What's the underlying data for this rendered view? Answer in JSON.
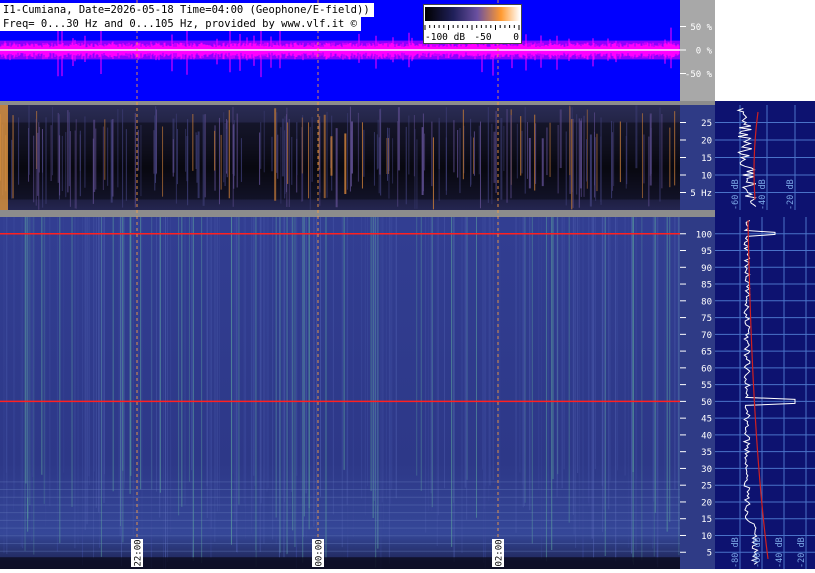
{
  "header": {
    "line1": "I1-Cumiana, Date=2026-05-18 Time=04:00 (Geophone/E-field))",
    "line2": "Freq= 0...30 Hz and 0...105 Hz, provided by www.vlf.it ©"
  },
  "colorbar": {
    "ticks": [
      "-100 dB",
      "-50",
      "0"
    ],
    "colors": [
      "#000000",
      "#20205a",
      "#6a50a0",
      "#ff9a30",
      "#ffffff"
    ]
  },
  "chart_data": [
    {
      "type": "line",
      "name": "waveform",
      "y_ticks": [
        "50 %",
        "0 %",
        "-50 %"
      ],
      "y_values": [
        50,
        0,
        -50
      ],
      "ylim": [
        -100,
        100
      ],
      "colors": {
        "background": "#0000ff",
        "trace": "#ff00ff"
      }
    },
    {
      "type": "heatmap",
      "name": "spectrogram-low",
      "y_ticks": [
        "25",
        "20",
        "15",
        "10",
        "5 Hz"
      ],
      "y_values": [
        25,
        20,
        15,
        10,
        5
      ],
      "ylim": [
        0,
        30
      ],
      "colors": {
        "background": "#1a1a3a"
      }
    },
    {
      "type": "heatmap",
      "name": "spectrogram-high",
      "y_ticks": [
        "100",
        "95",
        "90",
        "85",
        "80",
        "75",
        "70",
        "65",
        "60",
        "55",
        "50",
        "45",
        "40",
        "35",
        "30",
        "25",
        "20",
        "15",
        "10",
        "5"
      ],
      "y_values": [
        100,
        95,
        90,
        85,
        80,
        75,
        70,
        65,
        60,
        55,
        50,
        45,
        40,
        35,
        30,
        25,
        20,
        15,
        10,
        5
      ],
      "ylim": [
        0,
        105
      ],
      "time_labels": [
        "22:00",
        "00:00",
        "02:00"
      ],
      "marked_lines_hz": [
        100,
        50
      ],
      "colors": {
        "background": "#2b3585",
        "mains_line": "#ff2020"
      }
    },
    {
      "type": "line",
      "name": "spectrum-low",
      "x_ticks": [
        "-60 dB",
        "-40 dB",
        "-20 dB"
      ],
      "x_values": [
        -60,
        -40,
        -20
      ]
    },
    {
      "type": "line",
      "name": "spectrum-high",
      "x_ticks": [
        "-80 dB",
        "-60 dB",
        "-40 dB",
        "-20 dB"
      ],
      "x_values": [
        -80,
        -60,
        -40,
        -20
      ],
      "peaks_hz": [
        100,
        50
      ]
    }
  ]
}
